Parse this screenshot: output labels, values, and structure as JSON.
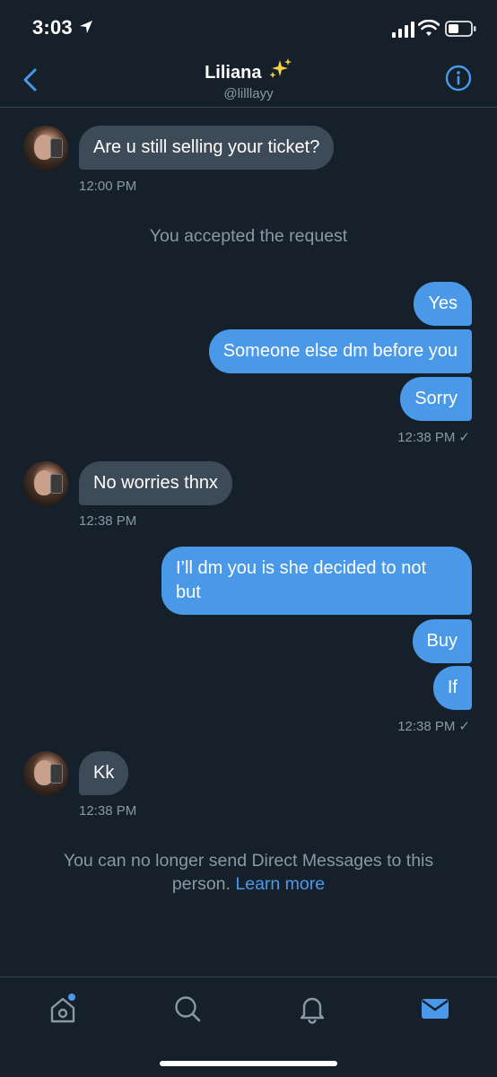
{
  "status_bar": {
    "time": "3:03"
  },
  "header": {
    "back_icon": "chevron-left-icon",
    "name": "Liliana",
    "name_emoji": "sparkles-icon",
    "handle": "@lilllayy",
    "info_icon": "info-circle-icon"
  },
  "conversation": {
    "msg1": {
      "text": "Are u still selling your ticket?",
      "time": "12:00 PM"
    },
    "system_accepted": "You accepted the request",
    "out1": {
      "lines": [
        "Yes",
        "Someone else dm before you",
        "Sorry"
      ],
      "time": "12:38 PM",
      "check": "✓"
    },
    "msg2": {
      "text": "No worries thnx",
      "time": "12:38 PM"
    },
    "out2": {
      "line1": "I’ll dm you is she decided to not",
      "line1b": "but",
      "line2": "Buy",
      "line3": "If",
      "time": "12:38 PM",
      "check": "✓"
    },
    "msg3": {
      "text": "Kk",
      "time": "12:38 PM"
    },
    "blocked_notice": "You can no longer send Direct Messages to this",
    "blocked_notice_2": "person.",
    "learn_more": "Learn more"
  },
  "bottom_nav": {
    "items": [
      "home-icon",
      "search-icon",
      "bell-icon",
      "mail-icon"
    ],
    "active": "mail-icon"
  },
  "colors": {
    "background": "#15202b",
    "accent": "#4a99e9",
    "incoming_bubble": "#3d4a57",
    "muted": "#8899a6"
  }
}
